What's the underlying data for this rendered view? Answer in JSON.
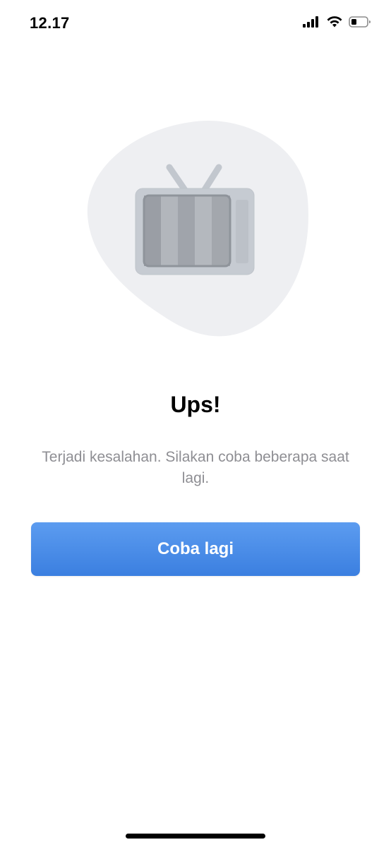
{
  "status_bar": {
    "time": "12.17",
    "icons": [
      "signal-icon",
      "wifi-icon",
      "battery-icon"
    ]
  },
  "illustration": {
    "icon": "tv-no-signal-icon",
    "blob_color": "#eeeff2"
  },
  "error": {
    "title": "Ups!",
    "message": "Terjadi kesalahan. Silakan coba beberapa saat lagi."
  },
  "actions": {
    "retry_label": "Coba lagi",
    "accent_color": "#4a8cea"
  }
}
